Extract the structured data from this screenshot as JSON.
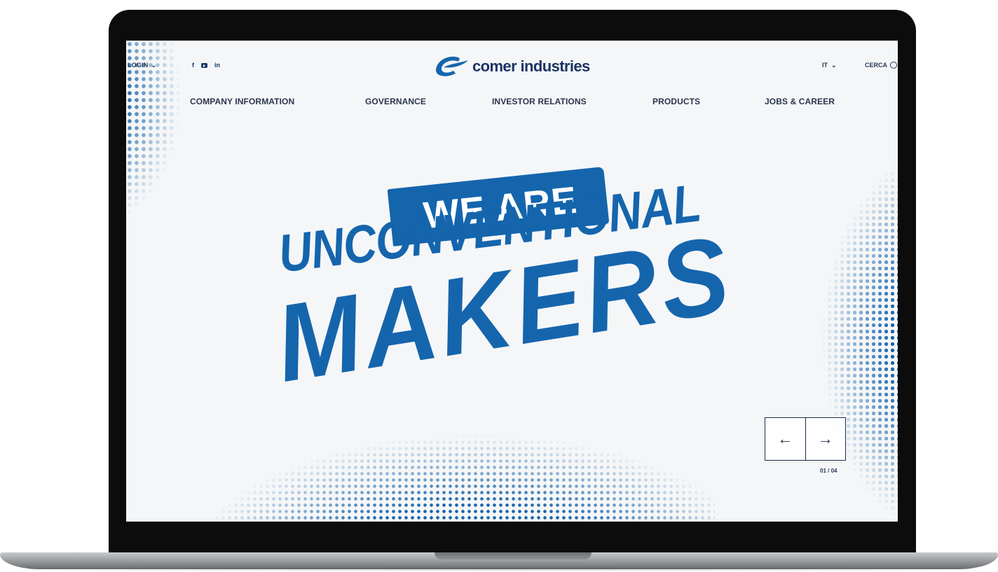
{
  "header": {
    "login_label": "LOGIN",
    "socials": [
      "f",
      "youtube",
      "in"
    ],
    "logo_text": "comer industries",
    "language": "IT",
    "search_label": "CERCA"
  },
  "nav": {
    "items": [
      {
        "label": "COMPANY INFORMATION"
      },
      {
        "label": "GOVERNANCE"
      },
      {
        "label": "INVESTOR RELATIONS"
      },
      {
        "label": "PRODUCTS"
      },
      {
        "label": "JOBS & CAREER"
      }
    ]
  },
  "hero": {
    "line1": "WE ARE",
    "line2": "UNCONVENTIONAL",
    "line3": "MAKERS"
  },
  "slider": {
    "prev_icon": "←",
    "next_icon": "→",
    "counter": "01 / 04"
  },
  "colors": {
    "brand_blue": "#1565ad",
    "navy": "#1c3466",
    "background": "#f5f6f7"
  }
}
